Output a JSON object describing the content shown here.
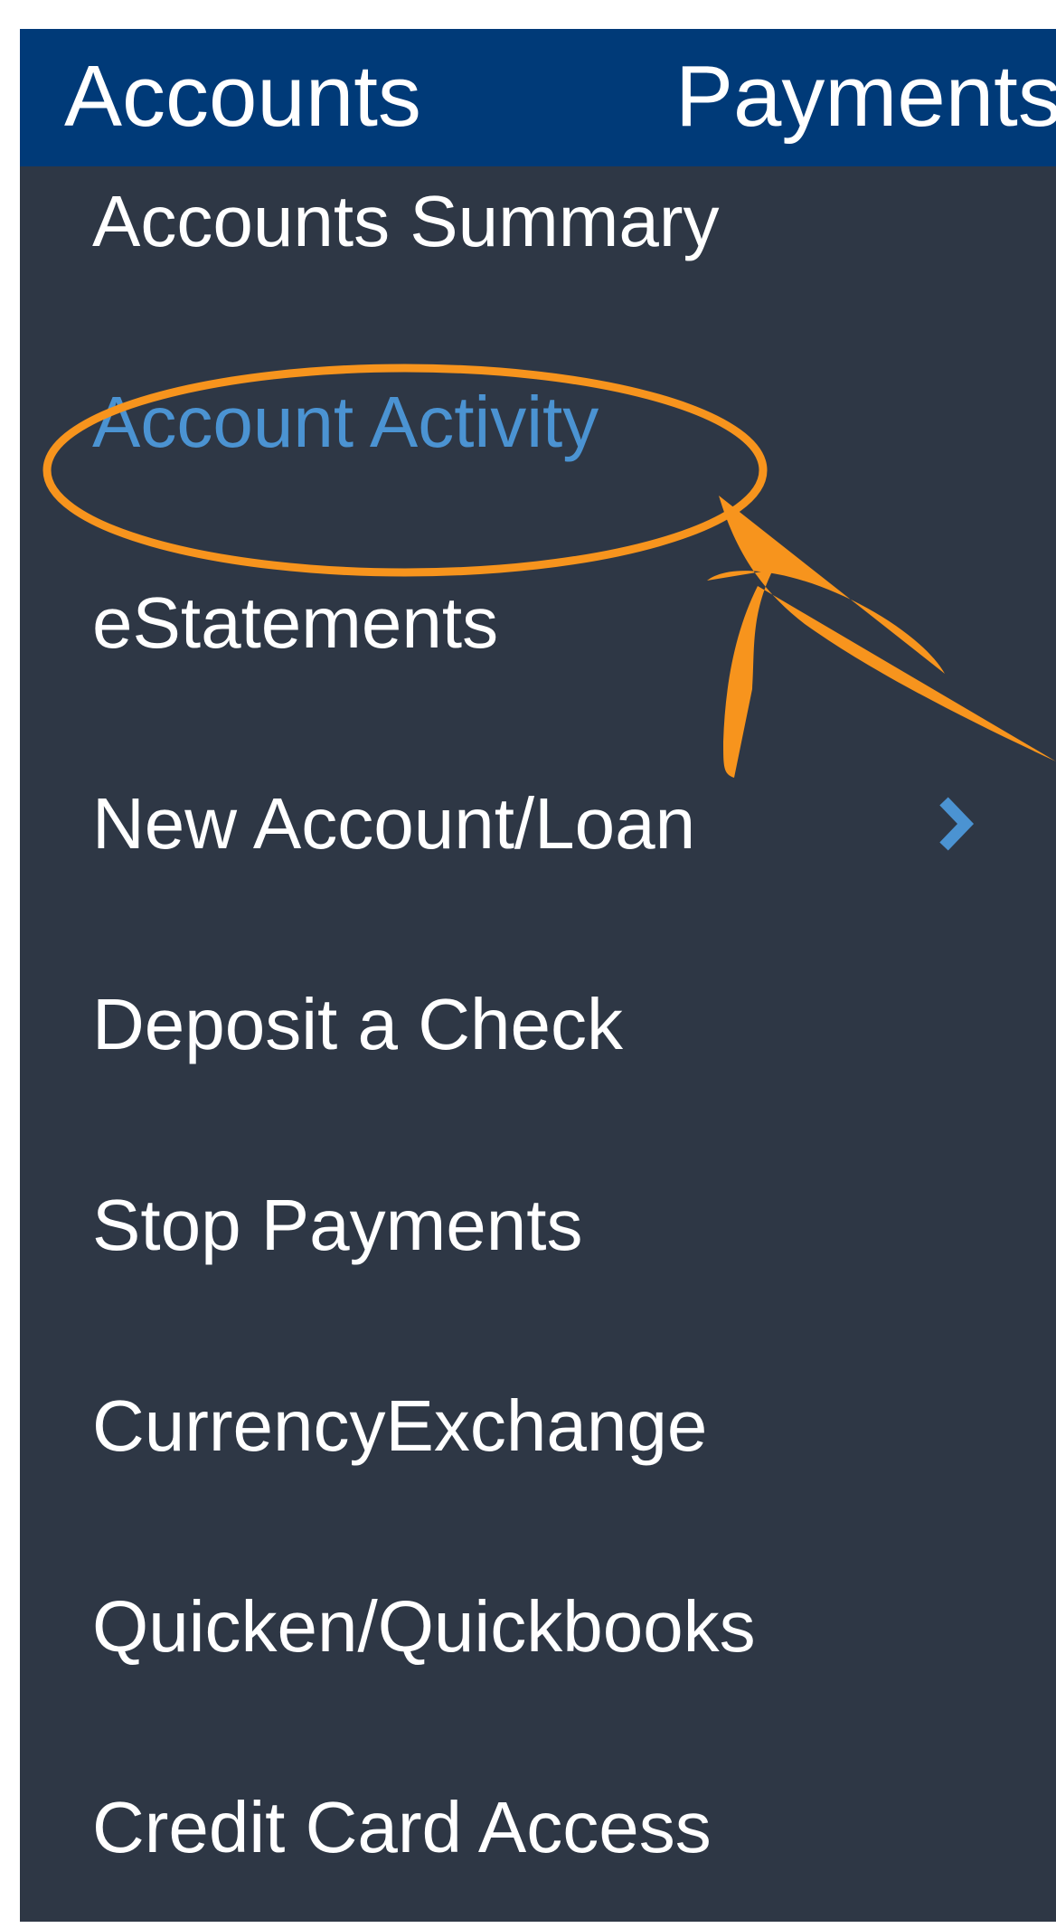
{
  "topnav": {
    "tabs": [
      {
        "label": "Accounts"
      },
      {
        "label": "Payments"
      }
    ]
  },
  "menu": {
    "items": [
      {
        "label": "Accounts Summary"
      },
      {
        "label": "Account Activity",
        "active": true
      },
      {
        "label": "eStatements"
      },
      {
        "label": "New Account/Loan",
        "has_submenu": true
      },
      {
        "label": "Deposit a Check"
      },
      {
        "label": "Stop Payments"
      },
      {
        "label": "CurrencyExchange"
      },
      {
        "label": "Quicken/Quickbooks"
      },
      {
        "label": "Credit Card Access"
      }
    ]
  },
  "icons": {
    "submenu": "chevron-right-icon"
  },
  "colors": {
    "nav_background": "#003a78",
    "menu_background": "#2e3745",
    "text": "#ffffff",
    "active_text": "#4b93d2",
    "annotation": "#f7941d"
  }
}
